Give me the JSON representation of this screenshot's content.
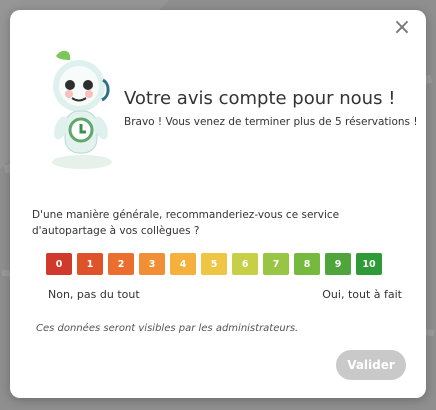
{
  "dialog": {
    "close_label": "×",
    "title": "Votre avis compte pour nous !",
    "subtitle": "Bravo ! Vous venez de terminer plus de 5 réservations !",
    "question": "D'une manière générale, recommanderiez-vous ce service d'autopartage à vos collègues ?",
    "scale": [
      {
        "label": "0",
        "color": "#cf3a2c"
      },
      {
        "label": "1",
        "color": "#df532b"
      },
      {
        "label": "2",
        "color": "#ea6f2e"
      },
      {
        "label": "3",
        "color": "#f18f36"
      },
      {
        "label": "4",
        "color": "#f5b13b"
      },
      {
        "label": "5",
        "color": "#efc643"
      },
      {
        "label": "6",
        "color": "#c7cf46"
      },
      {
        "label": "7",
        "color": "#98c544"
      },
      {
        "label": "8",
        "color": "#76b93f"
      },
      {
        "label": "9",
        "color": "#4fa53b"
      },
      {
        "label": "10",
        "color": "#2f9b38"
      }
    ],
    "left_label": "Non, pas du tout",
    "right_label": "Oui, tout à fait",
    "note": "Ces données seront visibles par les administrateurs.",
    "validate_label": "Valider",
    "mascot_icon": "robot-mascot-icon"
  }
}
